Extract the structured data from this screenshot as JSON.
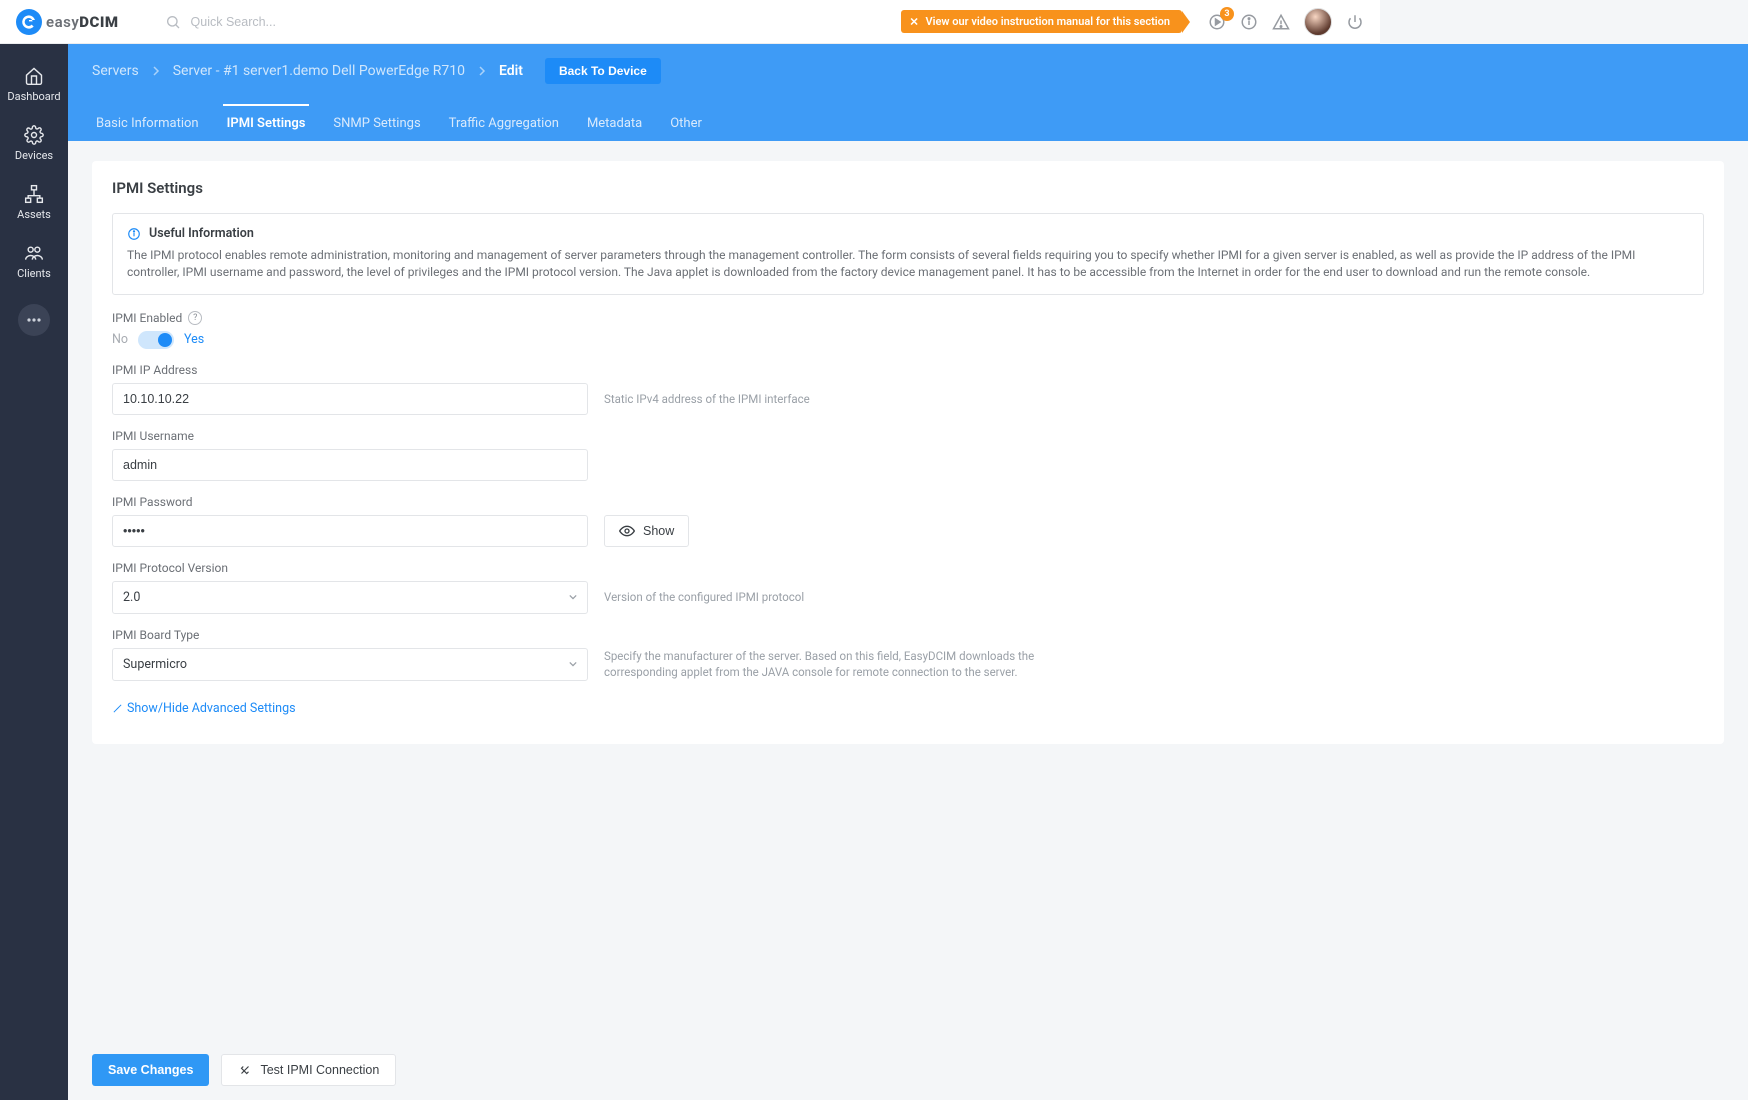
{
  "brand": {
    "name_part1": "easy",
    "name_part2": "DCIM"
  },
  "search_placeholder": "Quick Search...",
  "top": {
    "video_banner": "View our video instruction manual for this section",
    "play_badge": "3"
  },
  "sidebar": {
    "items": [
      {
        "label": "Dashboard"
      },
      {
        "label": "Devices"
      },
      {
        "label": "Assets"
      },
      {
        "label": "Clients"
      }
    ]
  },
  "breadcrumb": {
    "root": "Servers",
    "server": "Server - #1 server1.demo Dell PowerEdge R710",
    "current": "Edit",
    "back_label": "Back To Device"
  },
  "tabs": [
    {
      "label": "Basic Information",
      "active": false
    },
    {
      "label": "IPMI Settings",
      "active": true
    },
    {
      "label": "SNMP Settings",
      "active": false
    },
    {
      "label": "Traffic Aggregation",
      "active": false
    },
    {
      "label": "Metadata",
      "active": false
    },
    {
      "label": "Other",
      "active": false
    }
  ],
  "page_title": "IPMI Settings",
  "info": {
    "title": "Useful Information",
    "body": "The IPMI protocol enables remote administration, monitoring and management of server parameters through the management controller. The form consists of several fields requiring you to specify whether IPMI for a given server is enabled, as well as provide the IP address of the IPMI controller, IPMI username and password, the level of privileges and the IPMI protocol version. The Java applet is downloaded from the factory device management panel. It has to be accessible from the Internet in order for the end user to download and run the remote console."
  },
  "fields": {
    "enabled_label": "IPMI Enabled",
    "toggle_no": "No",
    "toggle_yes": "Yes",
    "ip_label": "IPMI IP Address",
    "ip_value": "10.10.10.22",
    "ip_hint": "Static IPv4 address of the IPMI interface",
    "user_label": "IPMI Username",
    "user_value": "admin",
    "pass_label": "IPMI Password",
    "pass_value": "•••••",
    "show_label": "Show",
    "proto_label": "IPMI Protocol Version",
    "proto_value": "2.0",
    "proto_hint": "Version of the configured IPMI protocol",
    "board_label": "IPMI Board Type",
    "board_value": "Supermicro",
    "board_hint": "Specify the manufacturer of the server. Based on this field, EasyDCIM downloads the corresponding applet from the JAVA console for remote connection to the server.",
    "advanced_link": "Show/Hide Advanced Settings"
  },
  "footer": {
    "save": "Save Changes",
    "test": "Test IPMI Connection"
  }
}
